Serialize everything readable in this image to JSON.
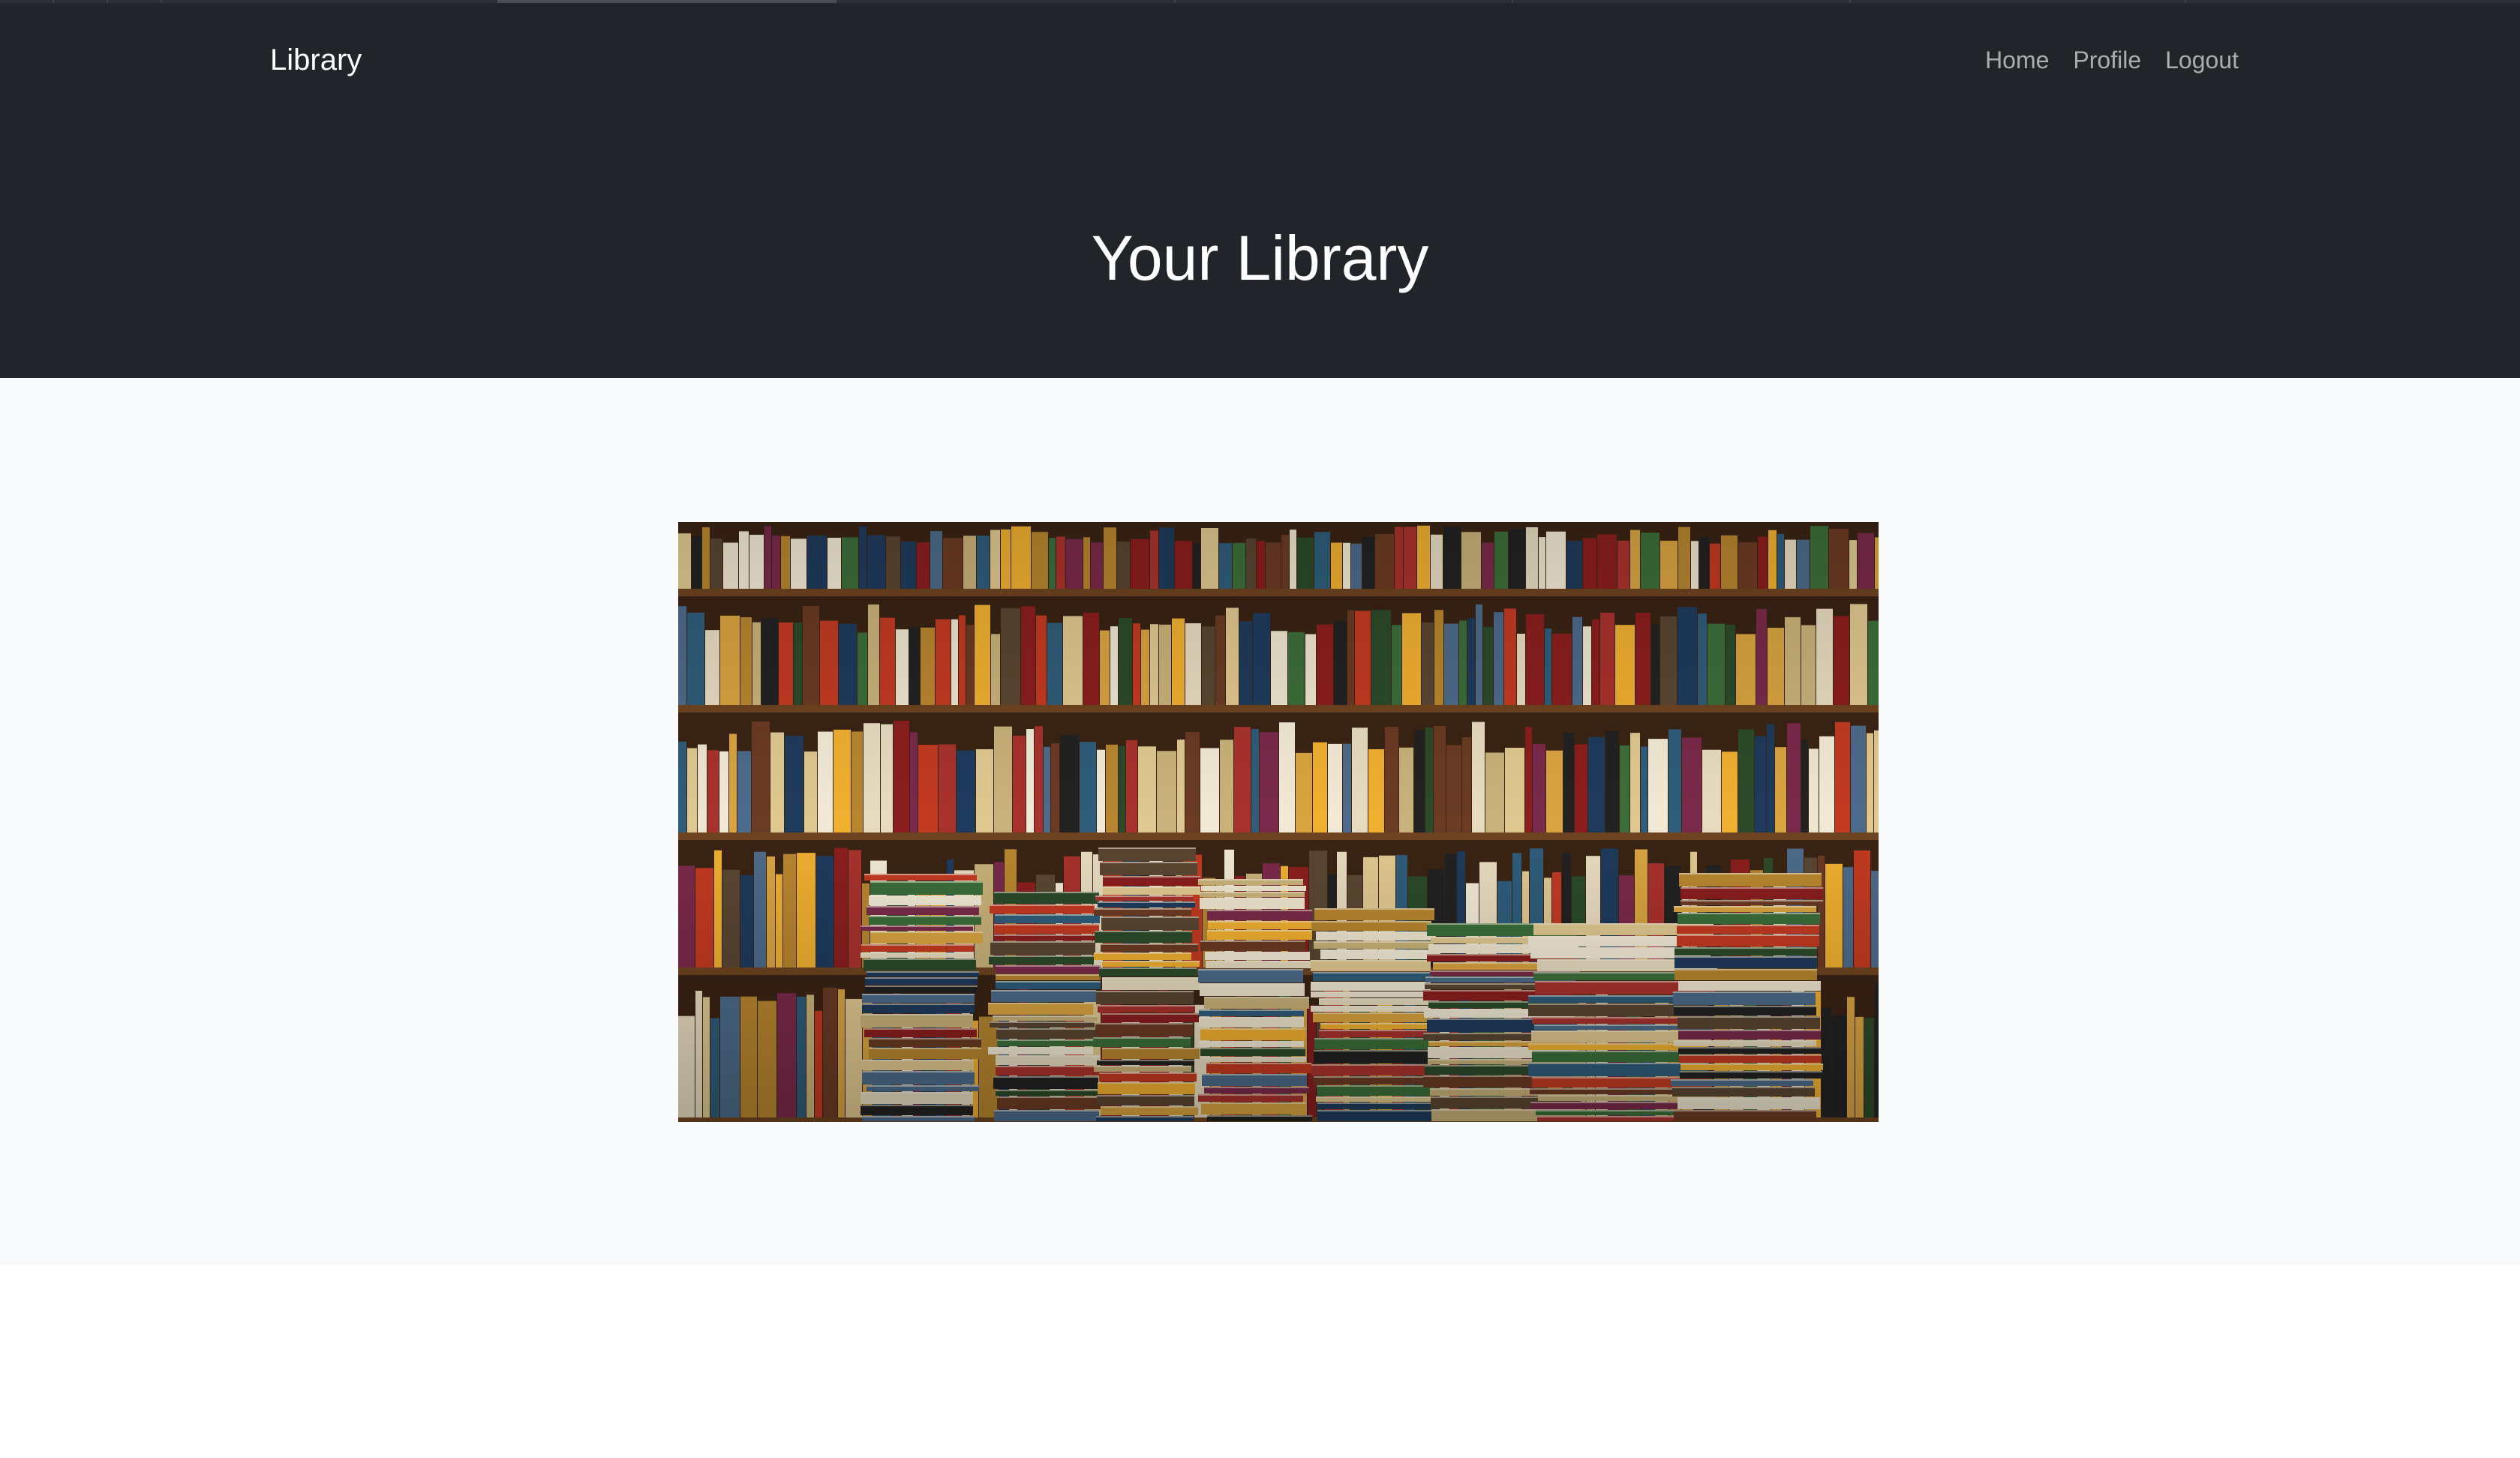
{
  "navbar": {
    "brand": "Library",
    "links": [
      {
        "label": "Home"
      },
      {
        "label": "Profile"
      },
      {
        "label": "Logout"
      }
    ]
  },
  "hero": {
    "title": "Your Library"
  },
  "image": {
    "alt": "Shelves and stacks of books"
  },
  "colors": {
    "navbar_bg": "#212529",
    "content_bg": "#f8f9fa",
    "text_light": "#ffffff",
    "link_muted": "rgba(255,255,255,0.62)"
  }
}
